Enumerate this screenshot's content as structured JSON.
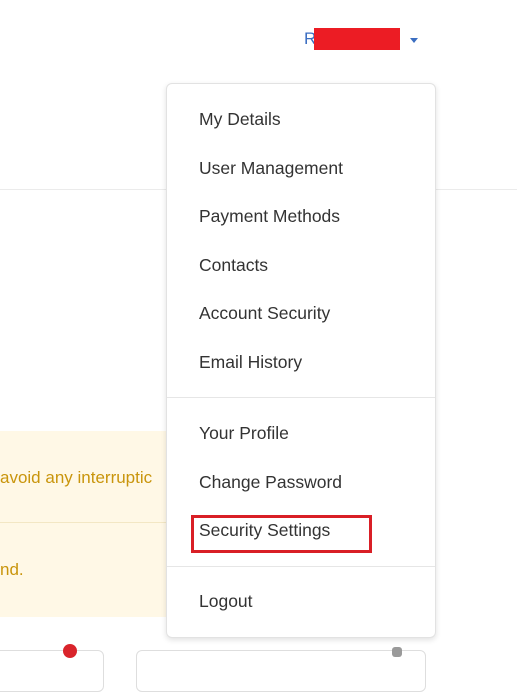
{
  "header": {
    "user_initial": "R",
    "redaction_color": "#ec1c24",
    "caret_icon": "caret-down-icon"
  },
  "background": {
    "warning_line_1": "avoid any interruptic",
    "warning_line_2": "nd."
  },
  "menu": {
    "section_1": [
      {
        "label": "My Details"
      },
      {
        "label": "User Management"
      },
      {
        "label": "Payment Methods"
      },
      {
        "label": "Contacts"
      },
      {
        "label": "Account Security"
      },
      {
        "label": "Email History"
      }
    ],
    "section_2": [
      {
        "label": "Your Profile"
      },
      {
        "label": "Change Password"
      },
      {
        "label": "Security Settings",
        "highlighted": true
      }
    ],
    "section_3": [
      {
        "label": "Logout"
      }
    ]
  },
  "colors": {
    "accent_blue": "#3b6ec1",
    "warning_text": "#c9950c",
    "warning_bg": "#fff8e6",
    "highlight_red": "#d91f26"
  }
}
